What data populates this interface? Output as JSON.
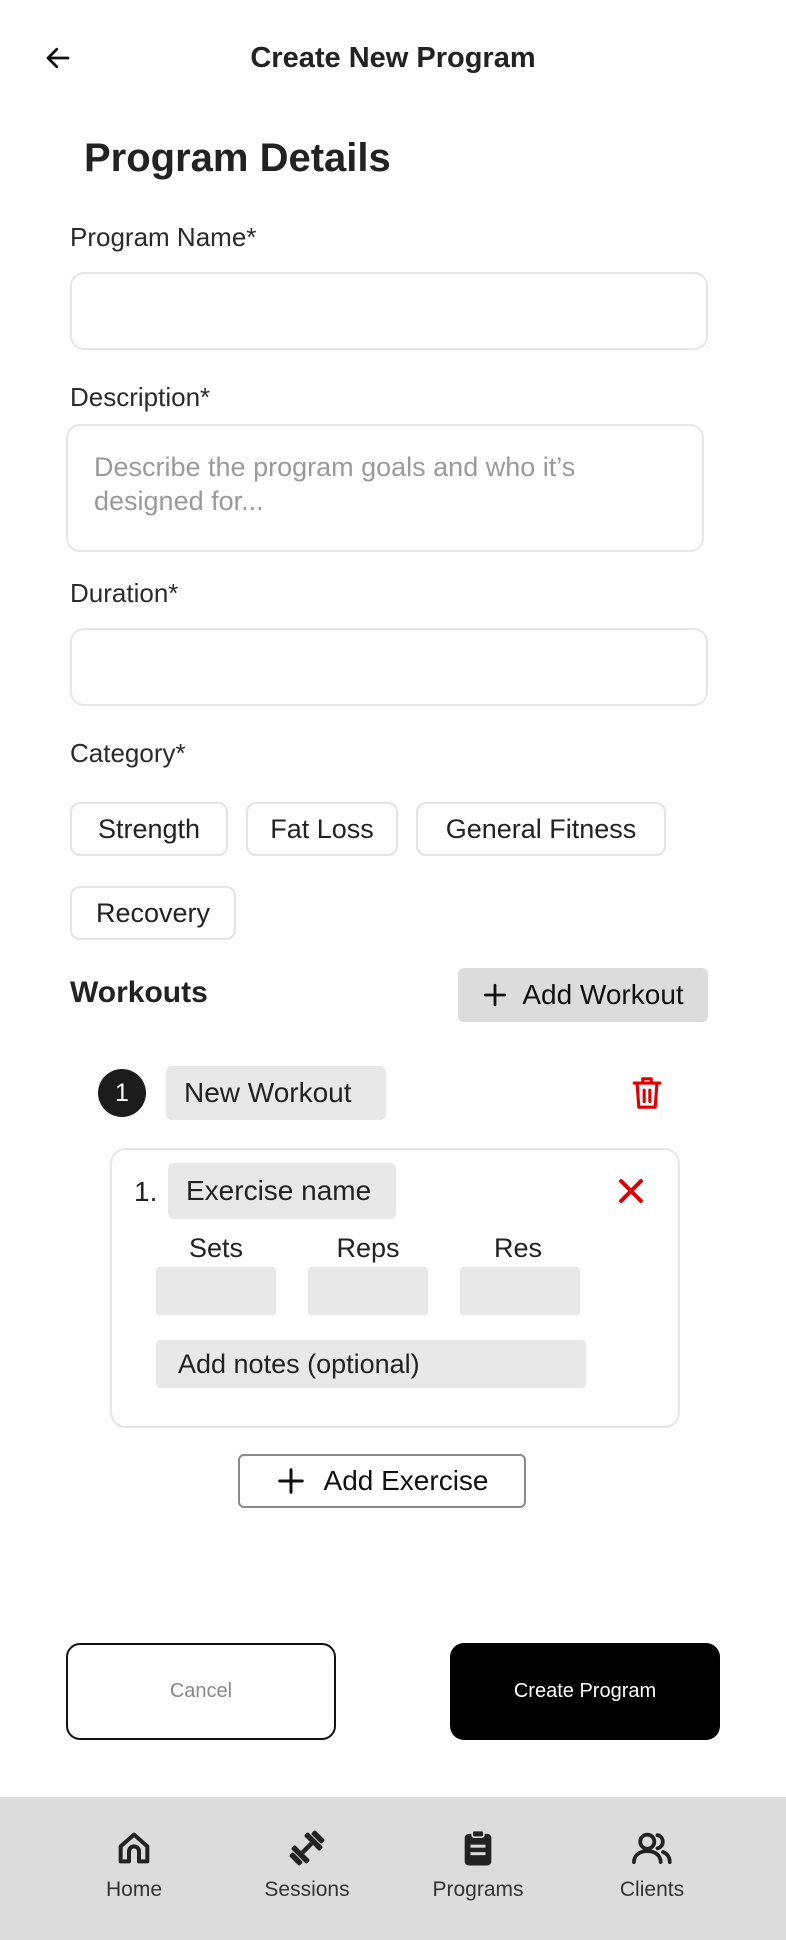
{
  "header": {
    "title": "Create New Program"
  },
  "form": {
    "section_title": "Program Details",
    "program_name": {
      "label": "Program Name*",
      "value": "",
      "placeholder": ""
    },
    "description": {
      "label": "Description*",
      "value": "",
      "placeholder": "Describe the program goals and who it’s designed for..."
    },
    "duration": {
      "label": "Duration*",
      "value": "",
      "placeholder": ""
    },
    "category": {
      "label": "Category*",
      "options": [
        "Strength",
        "Fat Loss",
        "General Fitness",
        "Recovery"
      ]
    }
  },
  "workouts": {
    "title": "Workouts",
    "add_label": "Add Workout",
    "items": [
      {
        "number": "1",
        "name": "New Workout",
        "exercises": [
          {
            "number": "1.",
            "name": "Exercise name",
            "sets_label": "Sets",
            "reps_label": "Reps",
            "rest_label": "Res",
            "notes_placeholder": "Add notes (optional)"
          }
        ]
      }
    ],
    "add_exercise_label": "Add Exercise"
  },
  "actions": {
    "cancel_label": "Cancel",
    "create_label": "Create Program"
  },
  "tabbar": {
    "items": [
      {
        "label": "Home",
        "icon": "home-icon"
      },
      {
        "label": "Sessions",
        "icon": "dumbbell-icon"
      },
      {
        "label": "Programs",
        "icon": "clipboard-icon"
      },
      {
        "label": "Clients",
        "icon": "users-icon"
      }
    ]
  },
  "colors": {
    "danger": "#e00000",
    "primary": "#000000",
    "chip_bg": "#e8e8e8",
    "tabbar_bg": "#dcdcdc"
  }
}
